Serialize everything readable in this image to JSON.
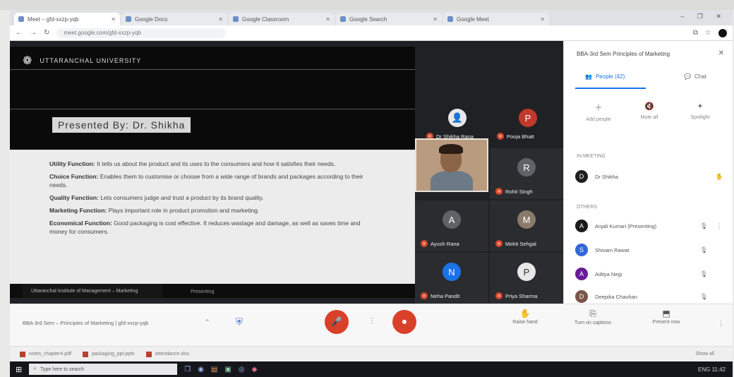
{
  "browser": {
    "tabs": [
      {
        "label": "Meet – gfd-xxzp-yqb"
      },
      {
        "label": "Google Docs"
      },
      {
        "label": "Google Classroom"
      },
      {
        "label": "Google Search"
      },
      {
        "label": "Google Meet"
      }
    ],
    "url": "meet.google.com/gfd-xxzp-yqb",
    "window_controls": "– ❐ ✕"
  },
  "slide": {
    "brand": "UTTARANCHAL UNIVERSITY",
    "title": "Presented By: Dr. Shikha",
    "bullets": [
      {
        "term": "Utility Function:",
        "text": "It tells us about the product and its uses to the consumers and how it satisfies their needs."
      },
      {
        "term": "Choice Function:",
        "text": "Enables them to customise or choose from a wide range of brands and packages according to their needs."
      },
      {
        "term": "Quality Function:",
        "text": "Lets consumers judge and trust a product by its brand quality."
      },
      {
        "term": "Marketing Function:",
        "text": "Plays important role in product promotion and marketing."
      },
      {
        "term": "Economical Function:",
        "text": "Good packaging is cost effective. It reduces wastage and damage, as well as saves time and money for consumers."
      }
    ],
    "caption": "Uttaranchal Institute of Management – Marketing",
    "caption_extra": "Presenting"
  },
  "tiles": {
    "top": [
      {
        "name": "Dr Shikha Rana",
        "glyph": "👤"
      },
      {
        "name": "Pooja Bhatt",
        "glyph": "P"
      }
    ],
    "grid": [
      {
        "name": "Ayush Rana",
        "glyph": "A"
      },
      {
        "name": "Rohit Singh",
        "glyph": "R"
      },
      {
        "name": "Mohit Sehgal",
        "glyph": "M"
      },
      {
        "name": "Neha Pandit",
        "glyph": "N"
      },
      {
        "name": "Priya Sharma",
        "glyph": "P"
      }
    ]
  },
  "controls": {
    "meeting_title": "BBA 3rd Sem – Principles of Marketing | gfd-xxzp-yqb",
    "mic_glyph": "🎤",
    "hangup_glyph": "☎",
    "cam_glyph": "⏺",
    "more_glyph": "⋮",
    "raise_hand": "Raise hand",
    "captions": "Turn on captions",
    "present": "Present now",
    "activities": "⋮"
  },
  "panel": {
    "title": "BBA-3rd Sem Principles of Marketing",
    "tabs": [
      {
        "label": "People (42)"
      },
      {
        "label": "Chat"
      }
    ],
    "actions": [
      {
        "label": "Add people",
        "glyph": "＋"
      },
      {
        "label": "Mute all",
        "glyph": "🔇"
      },
      {
        "label": "Spotlight",
        "glyph": "✦"
      }
    ],
    "section_you": "IN MEETING",
    "you": {
      "name": "Dr Shikha",
      "initial": "D",
      "color": "#1f1f1f"
    },
    "section_others": "OTHERS",
    "people": [
      {
        "name": "Anjali Kumari (Presenting)",
        "initial": "A",
        "color": "#1b1b1b"
      },
      {
        "name": "Shivam Rawat",
        "initial": "S",
        "color": "#3367d6"
      },
      {
        "name": "Aditya Negi",
        "initial": "A",
        "color": "#6a1b9a"
      },
      {
        "name": "Deepika Chauhan",
        "initial": "D",
        "color": "#795548"
      }
    ]
  },
  "downloads": [
    {
      "label": "notes_chapter4.pdf"
    },
    {
      "label": "packaging_ppt.pptx"
    },
    {
      "label": "attendance.xlsx"
    }
  ],
  "download_show_all": "Show all",
  "taskbar": {
    "search_placeholder": "Type here to search",
    "tray": "ENG  11:42"
  }
}
